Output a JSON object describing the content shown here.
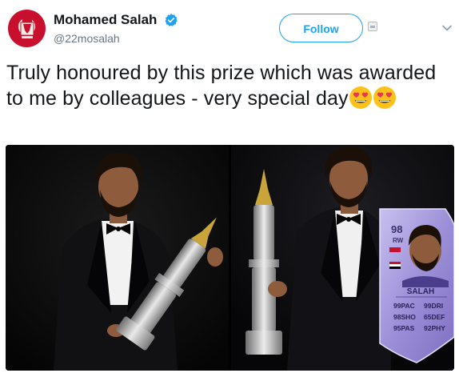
{
  "user": {
    "display_name": "Mohamed Salah",
    "handle": "@22mosalah",
    "verified": true
  },
  "follow_button": {
    "label": "Follow"
  },
  "tweet": {
    "text": "Truly honoured by this prize which was awarded to me by colleagues - very special day",
    "emojis": [
      "heart-eyes-emoji",
      "heart-eyes-emoji"
    ]
  },
  "media": {
    "card": {
      "rating": "98",
      "position": "RW",
      "name": "SALAH",
      "stats": [
        {
          "value": "99",
          "label": "PAC"
        },
        {
          "value": "99",
          "label": "DRI"
        },
        {
          "value": "98",
          "label": "SHO"
        },
        {
          "value": "65",
          "label": "DEF"
        },
        {
          "value": "95",
          "label": "PAS"
        },
        {
          "value": "92",
          "label": "PHY"
        }
      ]
    }
  },
  "colors": {
    "accent": "#1da1f2",
    "text": "#14171a",
    "secondary": "#657786",
    "card_purple": "#a69be0"
  },
  "icons": [
    "verified-badge-icon",
    "follow-plus-icon",
    "caret-down-icon"
  ]
}
